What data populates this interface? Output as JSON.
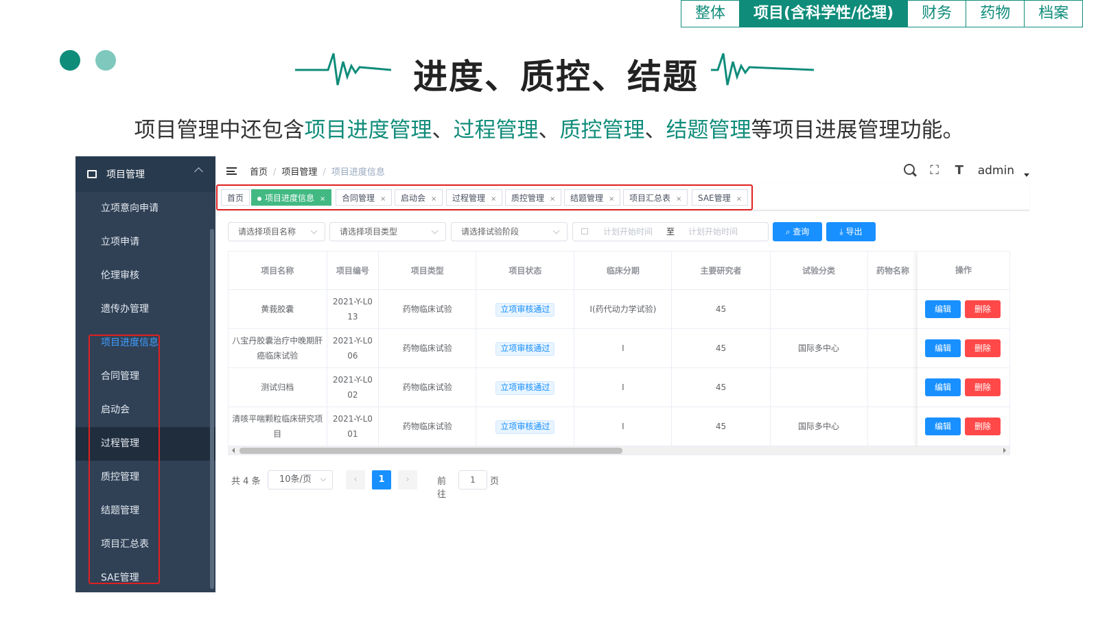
{
  "top_nav": {
    "tabs": [
      {
        "label": "整体",
        "active": false
      },
      {
        "label": "项目(含科学性/伦理)",
        "active": true
      },
      {
        "label": "财务",
        "active": false
      },
      {
        "label": "药物",
        "active": false
      },
      {
        "label": "档案",
        "active": false
      }
    ]
  },
  "colors": {
    "brand": "#0f8c7a",
    "brand_light": "#7fc8bd",
    "sidebar_bg": "#304156",
    "primary": "#1890ff",
    "danger": "#ff4949",
    "tag_active": "#42b983",
    "highlight_box": "#e02020"
  },
  "heading": "进度、质控、结题",
  "description": {
    "prefix": "项目管理中还包含",
    "highlight_1": "项目进度管理",
    "sep_1": "、",
    "highlight_2": "过程管理",
    "sep_2": "、",
    "highlight_3": "质控管理",
    "sep_3": "、",
    "highlight_4": "结题管理",
    "suffix": "等项目进展管理功能。"
  },
  "sidebar": {
    "title": "项目管理",
    "items": [
      {
        "label": "立项意向申请"
      },
      {
        "label": "立项申请"
      },
      {
        "label": "伦理审核"
      },
      {
        "label": "遗传办管理"
      },
      {
        "label": "项目进度信息"
      },
      {
        "label": "合同管理"
      },
      {
        "label": "启动会"
      },
      {
        "label": "过程管理"
      },
      {
        "label": "质控管理"
      },
      {
        "label": "结题管理"
      },
      {
        "label": "项目汇总表"
      },
      {
        "label": "SAE管理"
      }
    ]
  },
  "navbar": {
    "breadcrumb": [
      "首页",
      "项目管理",
      "项目进度信息"
    ],
    "breadcrumb_sep": "/",
    "user": "admin"
  },
  "tags": [
    {
      "label": "首页"
    },
    {
      "label": "项目进度信息"
    },
    {
      "label": "合同管理"
    },
    {
      "label": "启动会"
    },
    {
      "label": "过程管理"
    },
    {
      "label": "质控管理"
    },
    {
      "label": "结题管理"
    },
    {
      "label": "项目汇总表"
    },
    {
      "label": "SAE管理"
    }
  ],
  "tag_close": "×",
  "filters": {
    "project_name": "请选择项目名称",
    "project_type": "请选择项目类型",
    "trial_phase": "请选择试验阶段",
    "start_placeholder": "计划开始时间",
    "range_sep": "至",
    "end_placeholder": "计划开始时间",
    "query_label": "查询",
    "export_label": "导出"
  },
  "table": {
    "columns": [
      "项目名称",
      "项目编号",
      "项目类型",
      "项目状态",
      "临床分期",
      "主要研究者",
      "试验分类",
      "药物名称",
      "操作"
    ],
    "rows": [
      {
        "name": "黄莪胶囊",
        "code_1": "2021-Y-L0",
        "code_2": "13",
        "type": "药物临床试验",
        "status": "立项审核通过",
        "phase": "I(药代动力学试验)",
        "pi": "45",
        "category": "",
        "drug": ""
      },
      {
        "name": "八宝丹胶囊治疗中晚期肝癌临床试验",
        "code_1": "2021-Y-L0",
        "code_2": "06",
        "type": "药物临床试验",
        "status": "立项审核通过",
        "phase": "I",
        "pi": "45",
        "category": "国际多中心",
        "drug": ""
      },
      {
        "name": "测试归档",
        "code_1": "2021-Y-L0",
        "code_2": "02",
        "type": "药物临床试验",
        "status": "立项审核通过",
        "phase": "I",
        "pi": "45",
        "category": "",
        "drug": ""
      },
      {
        "name": "清咳平喘颗粒临床研究项目",
        "code_1": "2021-Y-L0",
        "code_2": "01",
        "type": "药物临床试验",
        "status": "立项审核通过",
        "phase": "I",
        "pi": "45",
        "category": "国际多中心",
        "drug": ""
      }
    ],
    "edit_label": "编辑",
    "delete_label": "删除"
  },
  "pagination": {
    "total_text": "共 4 条",
    "page_size": "10条/页",
    "current_page": "1",
    "goto_label": "前往",
    "goto_value": "1",
    "page_label": "页",
    "prev": "‹",
    "next": "›"
  }
}
